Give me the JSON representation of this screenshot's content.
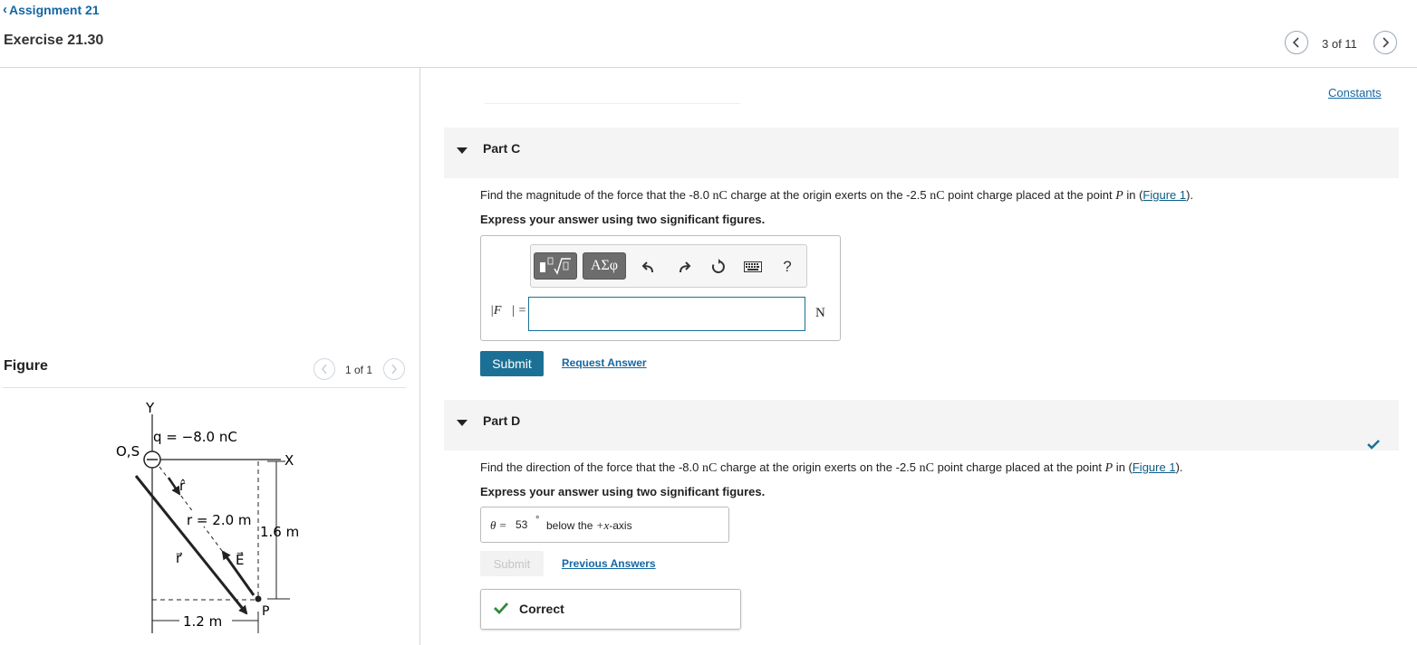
{
  "header": {
    "back_label": "Assignment 21",
    "title": "Exercise 21.30",
    "pager": "3 of 11"
  },
  "constants_link": "Constants",
  "figure": {
    "label": "Figure",
    "pager": "1 of 1",
    "diagram": {
      "axis_y": "Y",
      "axis_x": "X",
      "origin": "O,S",
      "charge": "q = −8.0 nC",
      "r_hat": "r̂",
      "r_label": "r = 2.0 m",
      "r_vec": "r⃗",
      "e_vec": "E⃗",
      "height": "1.6 m",
      "width": "1.2 m",
      "point": "P"
    }
  },
  "partC": {
    "label": "Part C",
    "q_pre": "Find the magnitude of the force that the -8.0 ",
    "q_unit1": "nC",
    "q_mid": " charge at the origin exerts on the -2.5 ",
    "q_unit2": "nC",
    "q_mid2": " point charge placed at the point ",
    "q_var": "P",
    "q_in": " in (",
    "q_link": "Figure 1",
    "q_end": ").",
    "instruction": "Express your answer using two significant figures.",
    "toolbar": {
      "templates_icon": "templates-icon",
      "greek": "ΑΣφ",
      "help": "?"
    },
    "answer_label": "|F⃗| =",
    "answer_value": "",
    "unit": "N",
    "submit": "Submit",
    "request": "Request Answer"
  },
  "partD": {
    "label": "Part D",
    "q_pre": "Find the direction of the force that the -8.0 ",
    "q_unit1": "nC",
    "q_mid": " charge at the origin exerts on the -2.5 ",
    "q_unit2": "nC",
    "q_mid2": " point charge placed at the point ",
    "q_var": "P",
    "q_in": " in (",
    "q_link": "Figure 1",
    "q_end": ").",
    "instruction": "Express your answer using two significant figures.",
    "answer_theta": "θ =",
    "answer_value": "53",
    "answer_deg": "°",
    "answer_suffix_pre": "below the ",
    "answer_suffix_var": "+x",
    "answer_suffix_post": "-axis",
    "submit": "Submit",
    "previous": "Previous Answers",
    "feedback": "Correct"
  },
  "colors": {
    "accent": "#1c7096",
    "link": "#1467a3",
    "correct": "#2e8b3e"
  }
}
